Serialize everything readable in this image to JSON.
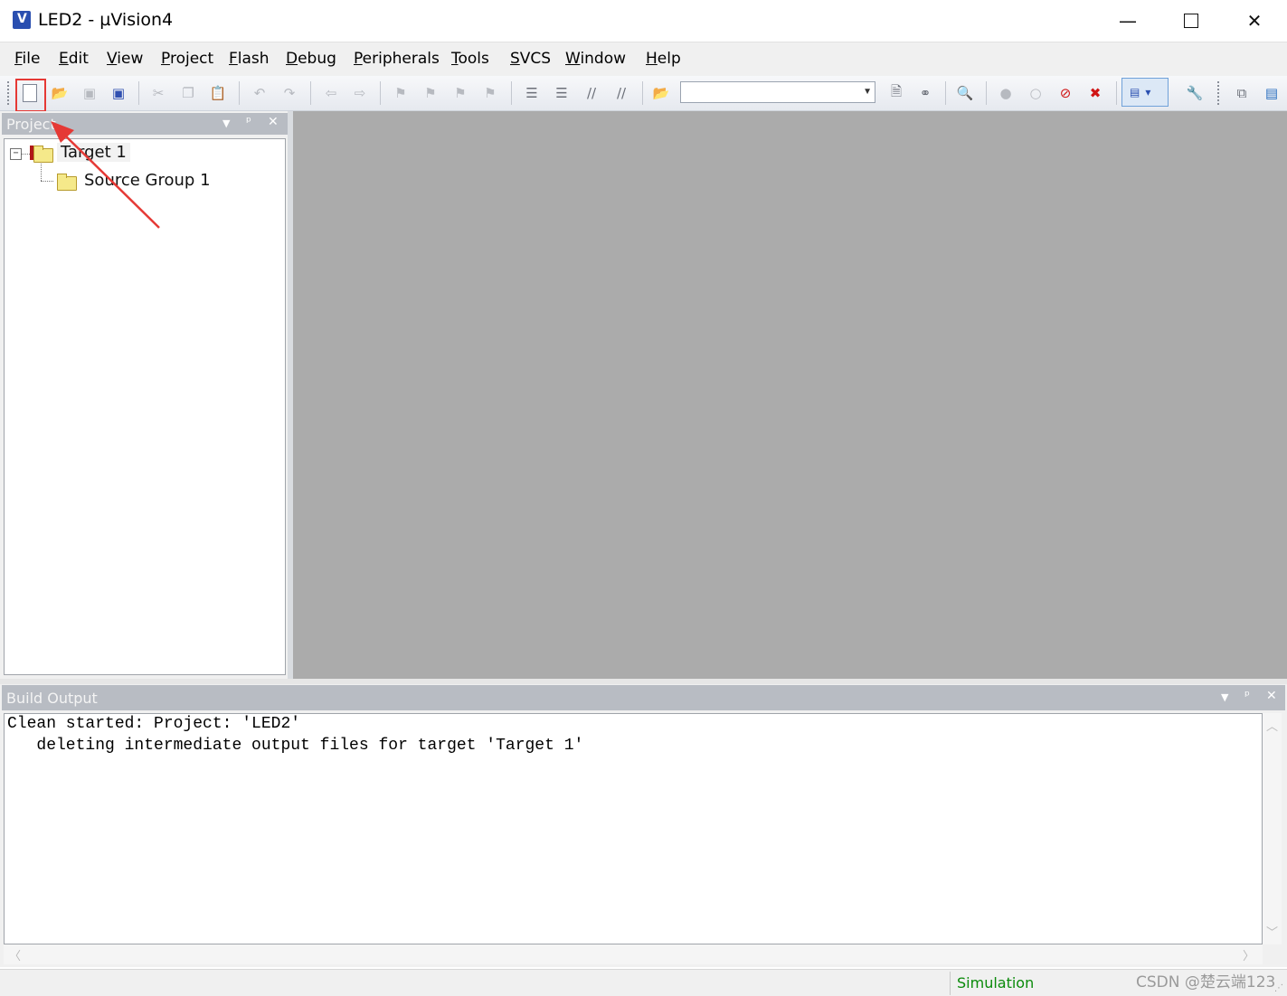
{
  "window": {
    "title": "LED2  - µVision4",
    "minimize": "—",
    "close": "✕"
  },
  "menu": [
    "File",
    "Edit",
    "View",
    "Project",
    "Flash",
    "Debug",
    "Peripherals",
    "Tools",
    "SVCS",
    "Window",
    "Help"
  ],
  "toolbar": {
    "target_combo_value": "",
    "highlighted_button": "new-file"
  },
  "project_panel": {
    "title": "Project",
    "controls": {
      "dropdown": "▼",
      "pin": "ᵖ",
      "close": "✕"
    },
    "tree": {
      "expand_glyph": "−",
      "target": "Target 1",
      "group": "Source Group 1"
    }
  },
  "build_output": {
    "title": "Build Output",
    "lines": [
      "Clean started: Project: 'LED2'",
      "   deleting intermediate output files for target 'Target 1'"
    ]
  },
  "status_bar": {
    "mode": "Simulation"
  },
  "watermark": "CSDN @楚云端123",
  "colors": {
    "editor_bg": "#ababab",
    "panel_header": "#b8bcc3",
    "annotation": "#e53935",
    "status_sim": "#0a8a0a"
  }
}
